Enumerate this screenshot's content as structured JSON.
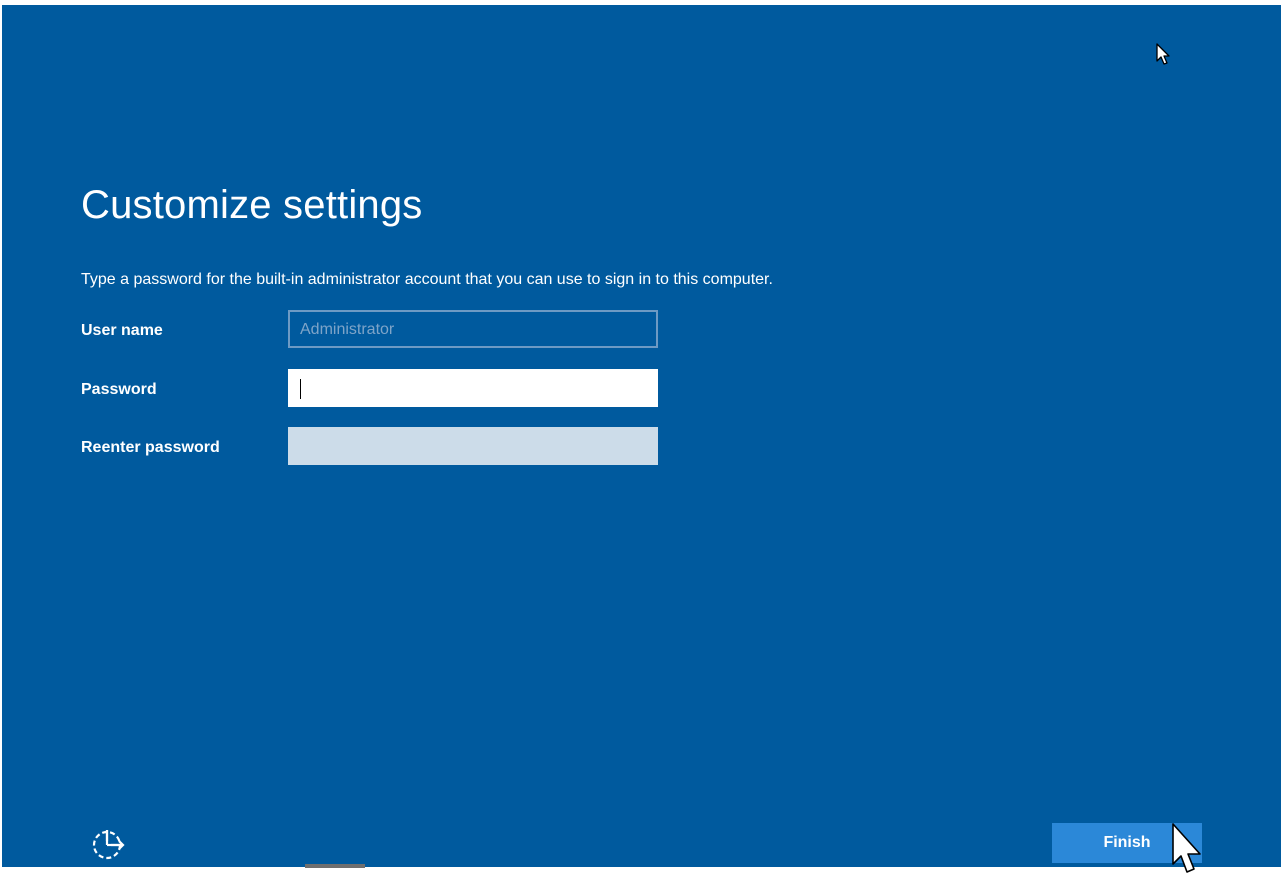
{
  "page": {
    "title": "Customize settings",
    "instructions": "Type a password for the built-in administrator account that you can use to sign in to this computer."
  },
  "form": {
    "username": {
      "label": "User name",
      "placeholder": "Administrator",
      "value": ""
    },
    "password": {
      "label": "Password",
      "value": ""
    },
    "reenter_password": {
      "label": "Reenter password",
      "value": ""
    }
  },
  "footer": {
    "finish_label": "Finish",
    "ease_of_access_icon": "ease-of-access-icon"
  },
  "colors": {
    "background": "#005a9e",
    "button": "#2b88d8",
    "disabled_field": "#ccdce9",
    "text": "#ffffff"
  }
}
